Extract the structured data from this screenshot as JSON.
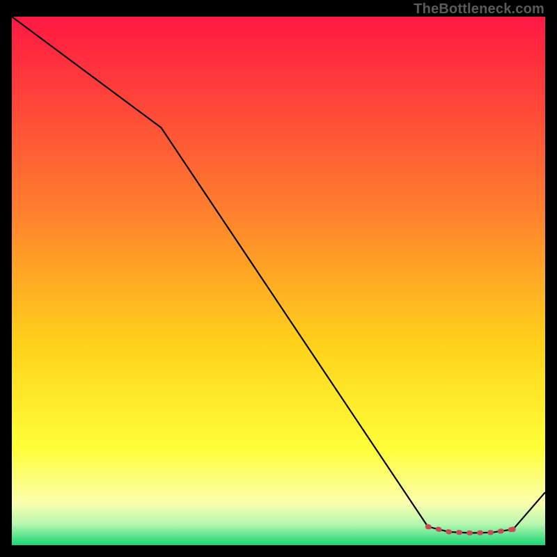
{
  "attribution": "TheBottleneck.com",
  "chart_data": {
    "type": "line",
    "title": "",
    "xlabel": "",
    "ylabel": "",
    "xlim": [
      0,
      100
    ],
    "ylim": [
      0,
      100
    ],
    "x": [
      0,
      28,
      78,
      82,
      86,
      90,
      94,
      100
    ],
    "values": [
      100,
      79,
      3.5,
      2.5,
      2.3,
      2.4,
      3.0,
      10
    ],
    "dotted_segment": {
      "x": [
        78,
        82,
        86,
        90,
        94
      ],
      "values": [
        3.5,
        2.5,
        2.3,
        2.4,
        3.0
      ],
      "color": "#c94a55"
    },
    "gradient_stops": [
      {
        "pos": 0.0,
        "color": "#ff1842"
      },
      {
        "pos": 0.35,
        "color": "#ff7a2f"
      },
      {
        "pos": 0.62,
        "color": "#ffd21a"
      },
      {
        "pos": 0.82,
        "color": "#ffff3a"
      },
      {
        "pos": 0.92,
        "color": "#fbffae"
      },
      {
        "pos": 0.96,
        "color": "#b7f7b0"
      },
      {
        "pos": 1.0,
        "color": "#17d672"
      }
    ]
  }
}
